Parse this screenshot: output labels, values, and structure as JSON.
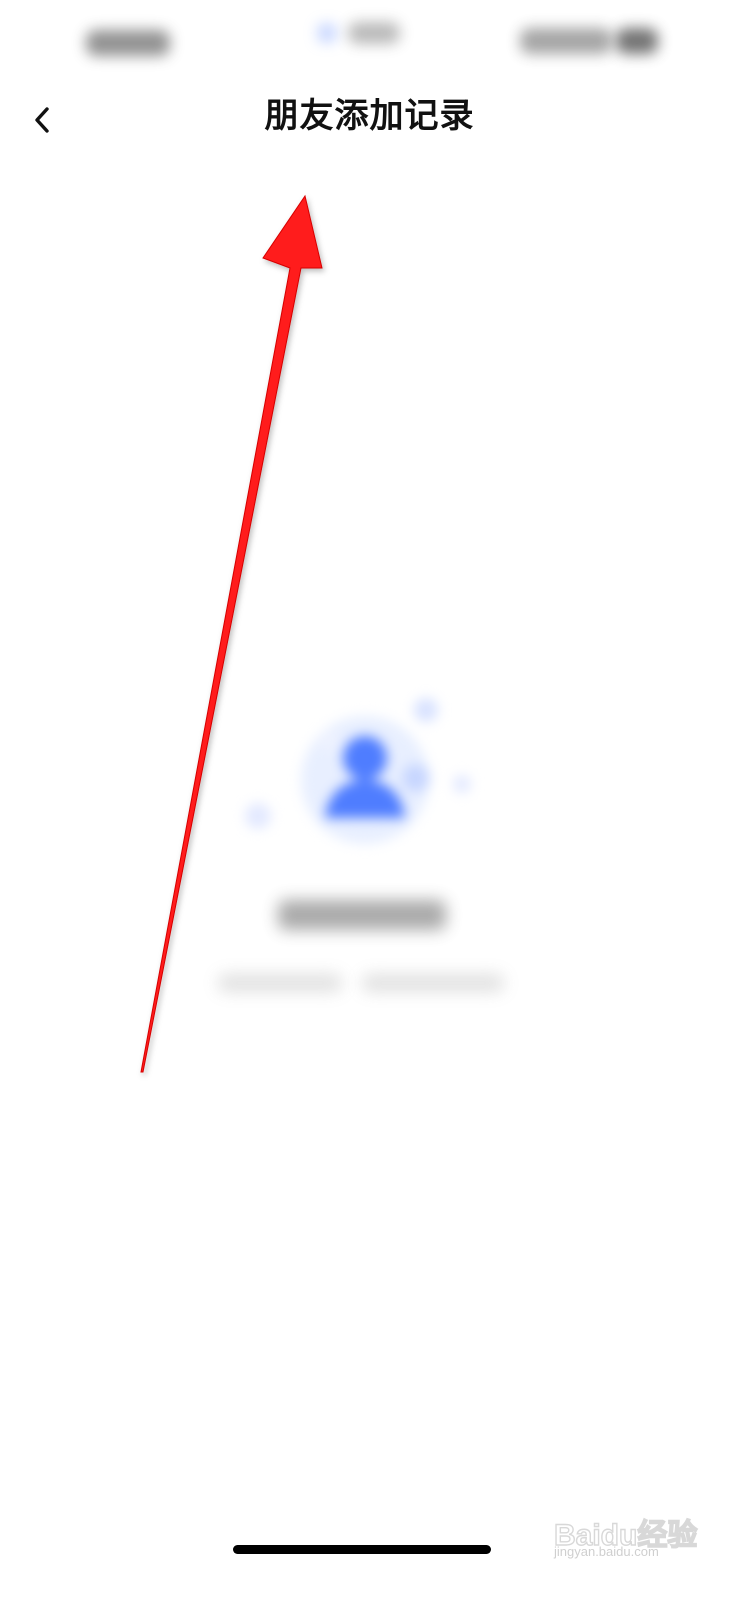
{
  "nav": {
    "title": "朋友添加记录",
    "back_icon": "chevron-left-icon"
  },
  "empty_state": {
    "icon": "user-avatar-icon",
    "accent_color": "#4f7dff"
  },
  "annotation": {
    "arrow_color": "#ff1a1a",
    "icon": "red-arrow-icon"
  },
  "watermark": {
    "text": "Baidu经验",
    "url_text": "jingyan.baidu.com"
  }
}
